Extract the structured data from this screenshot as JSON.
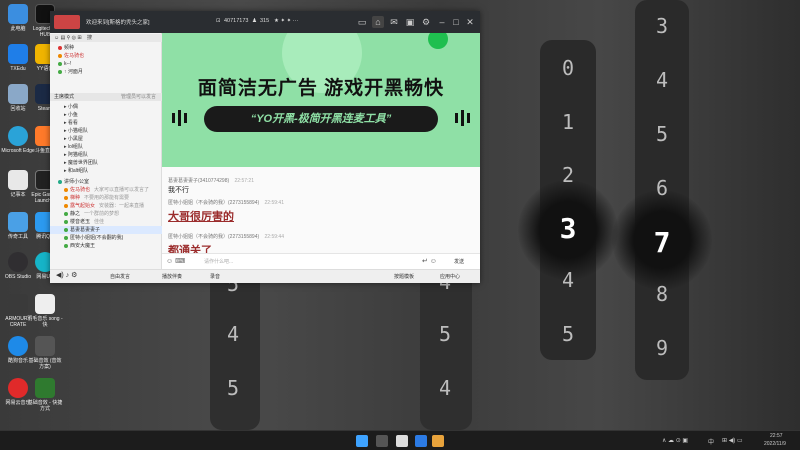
{
  "wallpaper": {
    "left_column": [
      "0",
      "1",
      "2",
      "3",
      "4",
      "5"
    ],
    "right_column_top": [
      "3",
      "4",
      "5",
      "6",
      "7",
      "8",
      "9"
    ],
    "mid_lower": [
      "4",
      "5",
      "4"
    ],
    "left_lower": [
      "5",
      "4",
      "5"
    ]
  },
  "desktop_icons": [
    {
      "label": "此电脑"
    },
    {
      "label": "Logitech G HUB"
    },
    {
      "label": "TXEdu"
    },
    {
      "label": "YY语音"
    },
    {
      "label": "回收站"
    },
    {
      "label": "Steam"
    },
    {
      "label": "Microsoft Edge"
    },
    {
      "label": "斗鱼直播"
    },
    {
      "label": "记事本"
    },
    {
      "label": "Epic Games Launcher"
    },
    {
      "label": "传奇工具"
    },
    {
      "label": "腾讯QQ"
    },
    {
      "label": "OBS Studio"
    },
    {
      "label": "网易UU"
    },
    {
      "label": "ARMOURY CRATE"
    },
    {
      "label": "羽毛音乐 song - 快"
    },
    {
      "label": "酷狗音乐"
    },
    {
      "label": "基础音效 (音效方案)"
    },
    {
      "label": "网易云音乐"
    },
    {
      "label": "基础音效 - 快捷方式"
    }
  ],
  "window": {
    "title": "欢迎来到[斯格的秃头之家]",
    "room_id": "40717173",
    "user_count": "315",
    "left_panel": {
      "search_placeholder": "搜",
      "channels": [
        "频种",
        "佐马骑也",
        "k--!",
        "↑ 河面月"
      ],
      "mode_label": "主席模式",
      "mode_right": "管理员可以发言",
      "groups": [
        "小偶",
        "小鱼",
        "看看",
        "小猫组队",
        "小黑屋",
        "lol组队",
        "阿猫组队",
        "魔兽世界团队",
        "和alt组队"
      ],
      "room": "讲师小公室",
      "members": [
        "佐马骑也",
        "梯种",
        "露气起始女",
        "静之",
        "楼音老玉",
        "葛妻葛妻妻子",
        "匿特小姐姐(不会翻的我)",
        "西安大魔王"
      ],
      "notes": [
        "大家可以直播可以发言了",
        "不要用的那能有需要",
        "安装器：一起来直播",
        "一个群前的梦想",
        "佳佳"
      ],
      "footer_voice": "自由发言",
      "footer_mic": "我的"
    },
    "banner": {
      "headline": "面简洁无广告  游戏开黑畅快",
      "tagline": "“YO开黑-极简开黑连麦工具”"
    },
    "chat": {
      "messages": [
        {
          "name": "葛妻葛妻妻子(3410774298)",
          "time": "22:57:21",
          "text": "我不行",
          "big": false
        },
        {
          "name": "匿特小姐姐（不会骑的我）(2273155894)",
          "time": "22:59:41",
          "text": "大哥很厉害的",
          "big": true
        },
        {
          "name": "匿特小姐姐（不会骑的我）(2273155894)",
          "time": "22:59:44",
          "text": "都通关了",
          "big": true
        }
      ],
      "input_placeholder": "请作什么吧...",
      "send_label": "发送"
    },
    "bottom_bar": {
      "voice_mode": "自由发言",
      "record": "播放伴奏",
      "effect": "录音",
      "right_mode": "按题模板",
      "app_center": "应用中心"
    }
  },
  "taskbar": {
    "time": "22:57",
    "date": "2022/11/9",
    "tray_lang": "中"
  }
}
